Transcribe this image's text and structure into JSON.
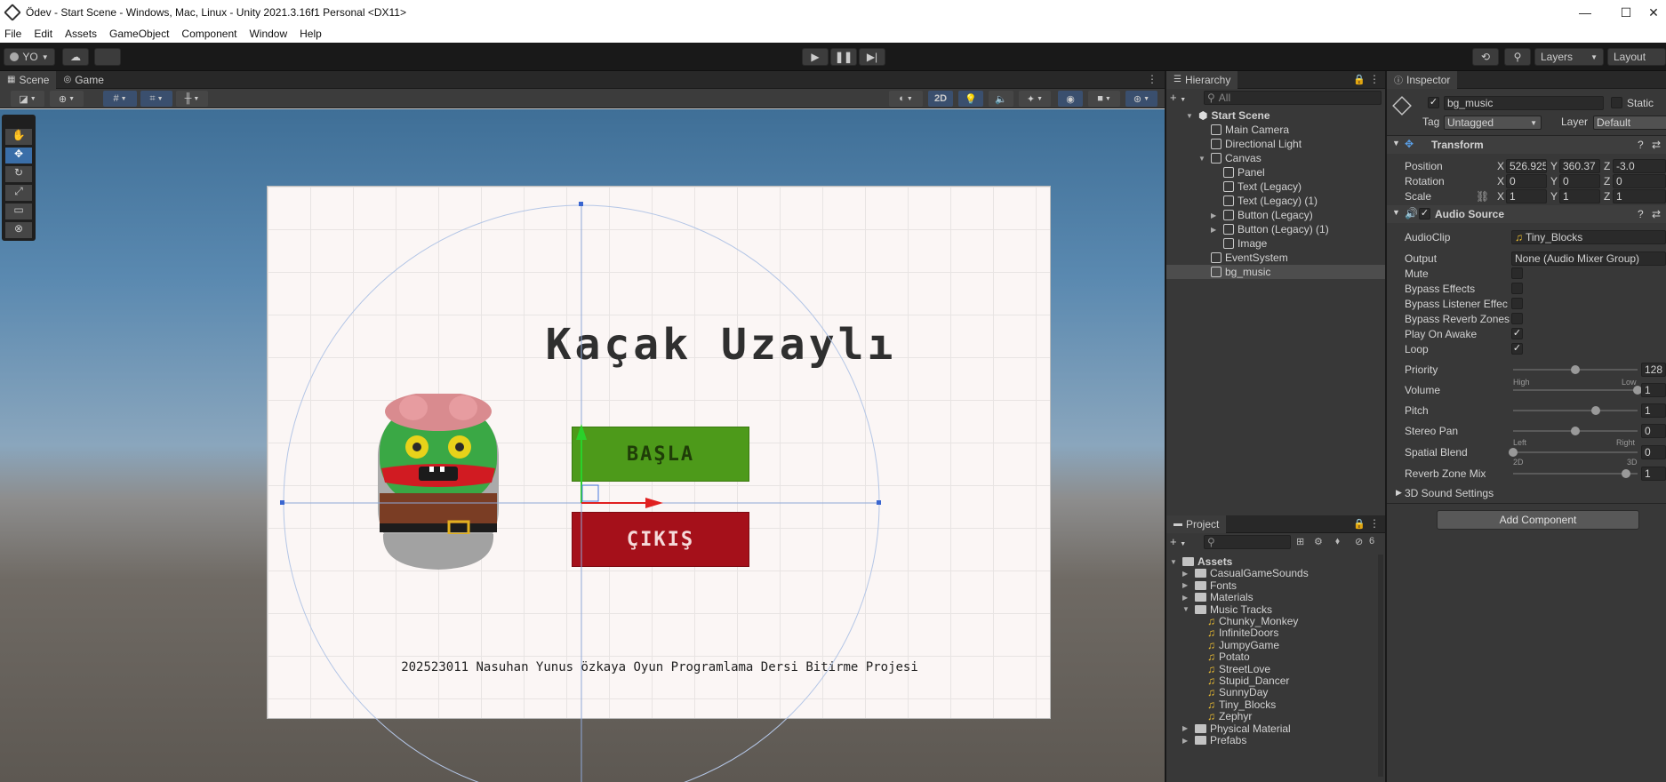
{
  "window": {
    "title": "Ödev - Start Scene - Windows, Mac, Linux - Unity 2021.3.16f1 Personal <DX11>"
  },
  "menu": [
    "File",
    "Edit",
    "Assets",
    "GameObject",
    "Component",
    "Window",
    "Help"
  ],
  "toolbar": {
    "account": "YO",
    "layers": "Layers",
    "layout": "Layout"
  },
  "tabs": {
    "scene": "Scene",
    "game": "Game",
    "hierarchy": "Hierarchy",
    "inspector": "Inspector",
    "project": "Project"
  },
  "scene_toolbar": {
    "mode_2d": "2D"
  },
  "game_ui": {
    "title": "Kaçak Uzaylı",
    "start_button": "BAŞLA",
    "exit_button": "ÇIKIŞ",
    "footer": "202523011 Nasuhan Yunus özkaya Oyun Programlama Dersi Bitirme Projesi"
  },
  "hierarchy": {
    "search_placeholder": "All",
    "items": [
      {
        "label": "Start Scene",
        "depth": 0,
        "kind": "scene",
        "expanded": true
      },
      {
        "label": "Main Camera",
        "depth": 1,
        "kind": "object"
      },
      {
        "label": "Directional Light",
        "depth": 1,
        "kind": "object"
      },
      {
        "label": "Canvas",
        "depth": 1,
        "kind": "object",
        "expanded": true
      },
      {
        "label": "Panel",
        "depth": 2,
        "kind": "object"
      },
      {
        "label": "Text (Legacy)",
        "depth": 2,
        "kind": "object"
      },
      {
        "label": "Text (Legacy) (1)",
        "depth": 2,
        "kind": "object"
      },
      {
        "label": "Button (Legacy)",
        "depth": 2,
        "kind": "object",
        "collapsed": true
      },
      {
        "label": "Button (Legacy) (1)",
        "depth": 2,
        "kind": "object",
        "collapsed": true
      },
      {
        "label": "Image",
        "depth": 2,
        "kind": "object"
      },
      {
        "label": "EventSystem",
        "depth": 1,
        "kind": "object"
      },
      {
        "label": "bg_music",
        "depth": 1,
        "kind": "object",
        "selected": true
      }
    ]
  },
  "project": {
    "hidden_count": "6",
    "items": [
      {
        "label": "Assets",
        "depth": 0,
        "kind": "folder",
        "expanded": true
      },
      {
        "label": "CasualGameSounds",
        "depth": 1,
        "kind": "folder"
      },
      {
        "label": "Fonts",
        "depth": 1,
        "kind": "folder"
      },
      {
        "label": "Materials",
        "depth": 1,
        "kind": "folder"
      },
      {
        "label": "Music Tracks",
        "depth": 1,
        "kind": "folder",
        "expanded": true
      },
      {
        "label": "Chunky_Monkey",
        "depth": 2,
        "kind": "audio"
      },
      {
        "label": "InfiniteDoors",
        "depth": 2,
        "kind": "audio"
      },
      {
        "label": "JumpyGame",
        "depth": 2,
        "kind": "audio"
      },
      {
        "label": "Potato",
        "depth": 2,
        "kind": "audio"
      },
      {
        "label": "StreetLove",
        "depth": 2,
        "kind": "audio"
      },
      {
        "label": "Stupid_Dancer",
        "depth": 2,
        "kind": "audio"
      },
      {
        "label": "SunnyDay",
        "depth": 2,
        "kind": "audio"
      },
      {
        "label": "Tiny_Blocks",
        "depth": 2,
        "kind": "audio"
      },
      {
        "label": "Zephyr",
        "depth": 2,
        "kind": "audio"
      },
      {
        "label": "Physical Material",
        "depth": 1,
        "kind": "folder"
      },
      {
        "label": "Prefabs",
        "depth": 1,
        "kind": "folder"
      }
    ]
  },
  "inspector": {
    "object_name": "bg_music",
    "static_label": "Static",
    "tag_label": "Tag",
    "tag_value": "Untagged",
    "layer_label": "Layer",
    "layer_value": "Default",
    "transform": {
      "title": "Transform",
      "position": {
        "label": "Position",
        "x": "526.925",
        "y": "360.37",
        "z": "-3.0"
      },
      "rotation": {
        "label": "Rotation",
        "x": "0",
        "y": "0",
        "z": "0"
      },
      "scale": {
        "label": "Scale",
        "x": "1",
        "y": "1",
        "z": "1"
      }
    },
    "audio_source": {
      "title": "Audio Source",
      "audioclip_label": "AudioClip",
      "audioclip_value": "Tiny_Blocks",
      "output_label": "Output",
      "output_value": "None (Audio Mixer Group)",
      "mute": {
        "label": "Mute",
        "checked": false
      },
      "bypass_effects": {
        "label": "Bypass Effects",
        "checked": false
      },
      "bypass_listener": {
        "label": "Bypass Listener Effec",
        "checked": false
      },
      "bypass_reverb": {
        "label": "Bypass Reverb Zones",
        "checked": false
      },
      "play_on_awake": {
        "label": "Play On Awake",
        "checked": true
      },
      "loop": {
        "label": "Loop",
        "checked": true
      },
      "priority": {
        "label": "Priority",
        "value": "128",
        "fraction": 0.5,
        "left": "High",
        "right": "Low"
      },
      "volume": {
        "label": "Volume",
        "value": "1",
        "fraction": 1.0
      },
      "pitch": {
        "label": "Pitch",
        "value": "1",
        "fraction": 0.667
      },
      "stereo_pan": {
        "label": "Stereo Pan",
        "value": "0",
        "fraction": 0.5,
        "left": "Left",
        "right": "Right"
      },
      "spatial_blend": {
        "label": "Spatial Blend",
        "value": "0",
        "fraction": 0.0,
        "left": "2D",
        "right": "3D"
      },
      "reverb_zone_mix": {
        "label": "Reverb Zone Mix",
        "value": "1",
        "fraction": 0.909
      },
      "sound_settings": "3D Sound Settings"
    },
    "add_component": "Add Component"
  }
}
